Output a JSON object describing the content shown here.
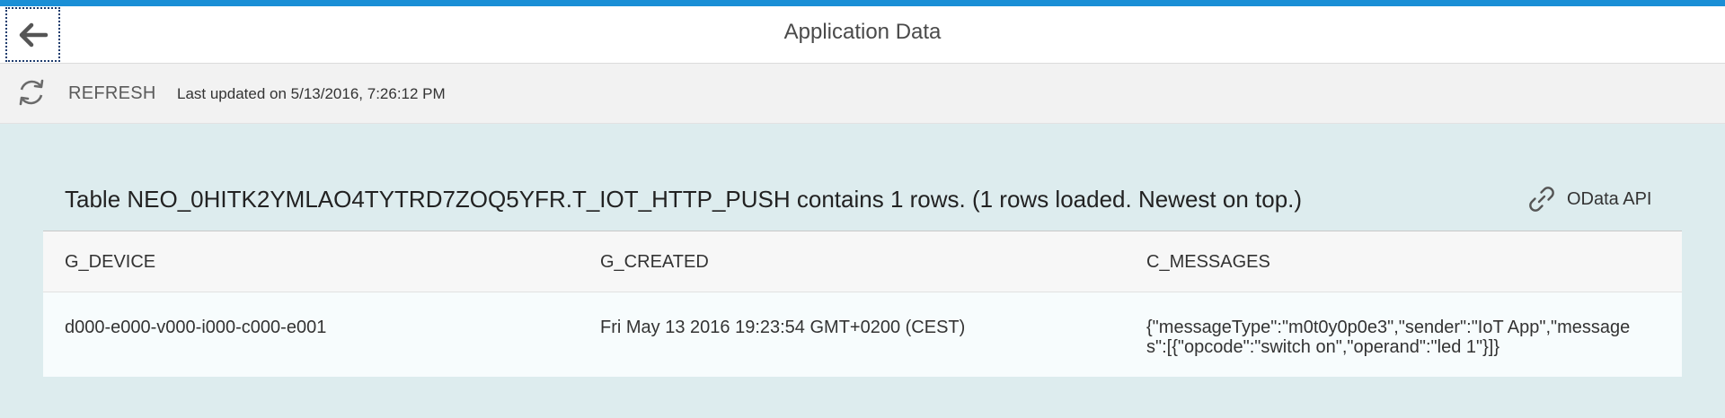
{
  "header": {
    "title": "Application Data",
    "back_icon": "arrow-left-icon"
  },
  "toolbar": {
    "refresh_icon": "refresh-icon",
    "refresh_label": "REFRESH",
    "last_updated": "Last updated on 5/13/2016, 7:26:12 PM"
  },
  "table_section": {
    "title": "Table NEO_0HITK2YMLAO4TYTRD7ZOQ5YFR.T_IOT_HTTP_PUSH contains 1 rows. (1 rows loaded. Newest on top.)",
    "odata_icon": "link-icon",
    "odata_label": "OData API"
  },
  "table": {
    "columns": [
      "G_DEVICE",
      "G_CREATED",
      "C_MESSAGES"
    ],
    "rows": [
      [
        "d000-e000-v000-i000-c000-e001",
        "Fri May 13 2016 19:23:54 GMT+0200 (CEST)",
        "{\"messageType\":\"m0t0y0p0e3\",\"sender\":\"IoT App\",\"messages\":[{\"opcode\":\"switch on\",\"operand\":\"led 1\"}]}"
      ]
    ]
  },
  "colors": {
    "accent": "#1a8fd6",
    "background": "#ddecee"
  }
}
